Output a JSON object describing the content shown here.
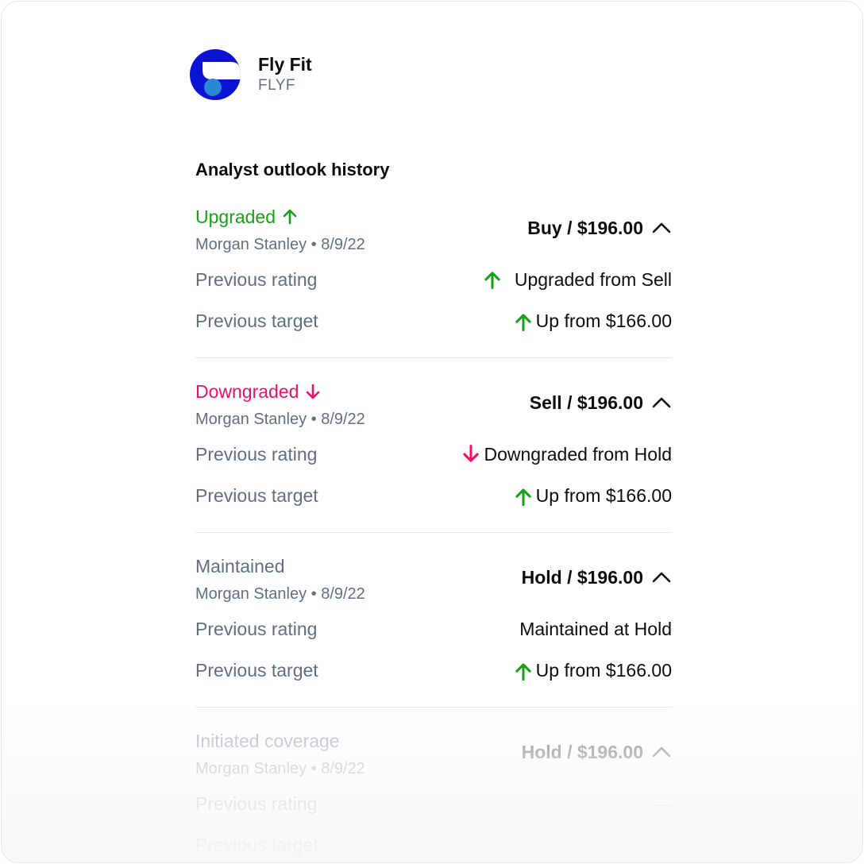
{
  "company": {
    "name": "Fly Fit",
    "ticker": "FLYF",
    "brand_color": "#0a12d4"
  },
  "section": {
    "title": "Analyst outlook history"
  },
  "colors": {
    "up": "#16a016",
    "down": "#ee0f6b",
    "neutral": "#5f6f82",
    "text": "#0d0d0d"
  },
  "entries": [
    {
      "action": "Upgraded",
      "action_icon": "arrow-up-icon",
      "meta": "Morgan Stanley • 8/9/22",
      "rating": "Buy / $196.00",
      "toggle_icon": "chevron-up-icon",
      "previous_rating_label": "Previous rating",
      "previous_rating_value": "Upgraded from Sell",
      "previous_rating_icon": "arrow-up-icon",
      "previous_target_label": "Previous target",
      "previous_target_value": "Up from $166.00",
      "previous_target_icon": "arrow-up-icon"
    },
    {
      "action": "Downgraded",
      "action_icon": "arrow-down-icon",
      "meta": "Morgan Stanley • 8/9/22",
      "rating": "Sell / $196.00",
      "toggle_icon": "chevron-up-icon",
      "previous_rating_label": "Previous rating",
      "previous_rating_value": "Downgraded from Hold",
      "previous_rating_icon": "arrow-down-icon",
      "previous_target_label": "Previous target",
      "previous_target_value": "Up from $166.00",
      "previous_target_icon": "arrow-up-icon"
    },
    {
      "action": "Maintained",
      "meta": "Morgan Stanley • 8/9/22",
      "rating": "Hold / $196.00",
      "toggle_icon": "chevron-up-icon",
      "previous_rating_label": "Previous rating",
      "previous_rating_value": "Maintained at Hold",
      "previous_target_label": "Previous target",
      "previous_target_value": "Up from $166.00",
      "previous_target_icon": "arrow-up-icon"
    },
    {
      "action": "Initiated coverage",
      "meta": "Morgan Stanley • 8/9/22",
      "rating": "Hold / $196.00",
      "toggle_icon": "chevron-up-icon",
      "previous_rating_label": "Previous rating",
      "previous_rating_value": "—",
      "previous_target_label": "Previous target",
      "previous_target_value": "—"
    }
  ]
}
